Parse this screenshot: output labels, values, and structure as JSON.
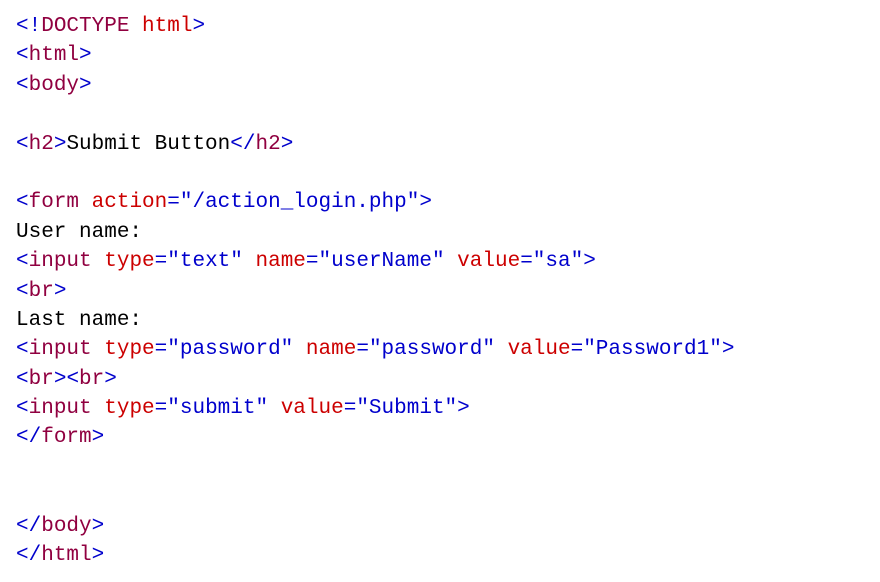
{
  "code": {
    "doctype": {
      "decl": "DOCTYPE",
      "root": "html"
    },
    "html_tag": "html",
    "body_tag": "body",
    "h2_tag": "h2",
    "h2_text": "Submit Button",
    "form_tag": "form",
    "form_action_attr": "action",
    "form_action_value": "\"/action_login.php\"",
    "label_username": "User name:",
    "input_tag": "input",
    "type_attr": "type",
    "name_attr": "name",
    "value_attr": "value",
    "username_type": "\"text\"",
    "username_name": "\"userName\"",
    "username_value": "\"sa\"",
    "br_tag": "br",
    "label_lastname": "Last name:",
    "password_type": "\"password\"",
    "password_name": "\"password\"",
    "password_value": "\"Password1\"",
    "submit_type": "\"submit\"",
    "submit_value": "\"Submit\""
  }
}
